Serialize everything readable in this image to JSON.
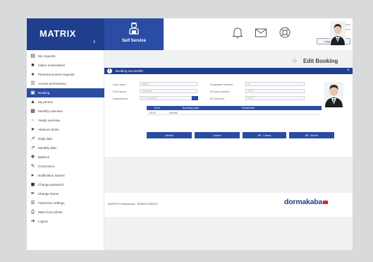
{
  "header": {
    "brand": "MATRIX",
    "self_service_label": "Self Service",
    "user_name": "Wooden Name",
    "user_role": "Name",
    "logoff_label": "Logoff in 5 min"
  },
  "sidebar": {
    "items": [
      {
        "label": "My requests",
        "icon": "inbox-icon"
      },
      {
        "label": "Visitor reservations",
        "icon": "visitor-icon"
      },
      {
        "label": "Personal access requests",
        "icon": "people-icon"
      },
      {
        "label": "Access permissions",
        "icon": "list-icon"
      },
      {
        "label": "Booking",
        "icon": "booking-icon",
        "active": true
      },
      {
        "label": "My person",
        "icon": "person-icon"
      },
      {
        "label": "Monthly overview",
        "icon": "chart-icon"
      },
      {
        "label": "Yearly overview",
        "icon": "bars-icon"
      },
      {
        "label": "Absence times",
        "icon": "plane-icon"
      },
      {
        "label": "Daily data",
        "icon": "daily-icon"
      },
      {
        "label": "Monthly data",
        "icon": "trend-icon"
      },
      {
        "label": "Balance",
        "icon": "balance-icon"
      },
      {
        "label": "Corrections",
        "icon": "wrench-icon"
      },
      {
        "label": "Notification actions",
        "icon": "megaphone-icon"
      },
      {
        "label": "Change password",
        "icon": "lock-icon"
      },
      {
        "label": "Change theme",
        "icon": "brush-icon"
      },
      {
        "label": "Fixed time settings",
        "icon": "settings-icon"
      },
      {
        "label": "Mass form printer",
        "icon": "printer-icon"
      },
      {
        "label": "Logout",
        "icon": "logout-icon"
      }
    ]
  },
  "main": {
    "title": "Edit Booking",
    "dialog": {
      "title": "Booking successful",
      "fields": {
        "last_name_label": "Last name",
        "last_name_value": "Name",
        "first_name_label": "First name",
        "first_name_value": "Vorname",
        "department_label": "Department",
        "department_value": "1 - Production",
        "employee_number_label": "Employee number",
        "employee_number_value": "11",
        "id_card_number_label": "ID card number",
        "id_card_number_value": "2100",
        "id_card_text_label": "ID card text",
        "id_card_text_value": "2101"
      },
      "table": {
        "headers": [
          "Time",
          "Booking type",
          "Parameter"
        ],
        "rows": [
          {
            "time": "12:10",
            "type": "Arrival",
            "parameter": ""
          }
        ]
      },
      "buttons": [
        "Arrival",
        "Leave",
        "Mi - Leave",
        "Mi - Arrive"
      ]
    },
    "footer_text": "MATRIX Professional - DEMOLICENCE",
    "logo_text": "dormakaba"
  },
  "colors": {
    "brand_dark": "#203e8e",
    "brand": "#2a4da3",
    "logo_accent": "#e2231a"
  }
}
